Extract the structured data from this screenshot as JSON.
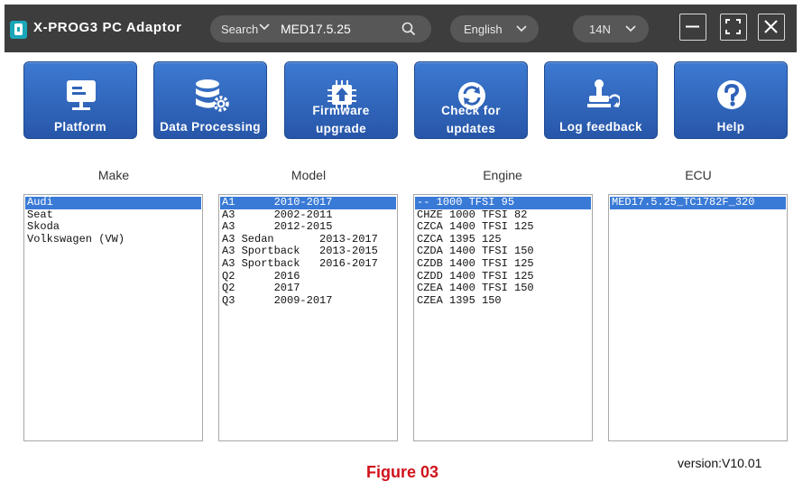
{
  "app": {
    "title": "X-PROG3 PC Adaptor"
  },
  "search": {
    "label": "Search",
    "value": "MED17.5.25"
  },
  "language": {
    "value": "English"
  },
  "timezone": {
    "value": "14N"
  },
  "tiles": [
    {
      "label": "Platform",
      "icon": "monitor-icon"
    },
    {
      "label": "Data Processing",
      "icon": "database-gear-icon"
    },
    {
      "label": "Firmware upgrade",
      "icon": "chip-upload-icon"
    },
    {
      "label": "Check for updates",
      "icon": "refresh-icon"
    },
    {
      "label": "Log feedback",
      "icon": "stamp-icon"
    },
    {
      "label": "Help",
      "icon": "question-icon"
    }
  ],
  "columns": {
    "make": "Make",
    "model": "Model",
    "engine": "Engine",
    "ecu": "ECU"
  },
  "make_items": [
    "Audi",
    "Seat",
    "Skoda",
    "Volkswagen (VW)"
  ],
  "model_items": [
    "A1      2010-2017",
    "A3      2002-2011",
    "A3      2012-2015",
    "A3 Sedan       2013-2017",
    "A3 Sportback   2013-2015",
    "A3 Sportback   2016-2017",
    "Q2      2016",
    "Q2      2017",
    "Q3      2009-2017"
  ],
  "engine_items": [
    "-- 1000 TFSI 95",
    "CHZE 1000 TFSI 82",
    "CZCA 1400 TFSI 125",
    "CZCA 1395 125",
    "CZDA 1400 TFSI 150",
    "CZDB 1400 TFSI 125",
    "CZDD 1400 TFSI 125",
    "CZEA 1400 TFSI 150",
    "CZEA 1395 150"
  ],
  "ecu_items": [
    "MED17.5.25_TC1782F_320"
  ],
  "selected": {
    "make": 0,
    "model": 0,
    "engine": 0,
    "ecu": 0
  },
  "footer": {
    "version": "version:V10.01",
    "figure": "Figure 03"
  },
  "colors": {
    "tile": "#2f63b8",
    "selection": "#3a7ad7",
    "titlebar": "#3d3d3d",
    "figure_caption": "#d0121b"
  }
}
